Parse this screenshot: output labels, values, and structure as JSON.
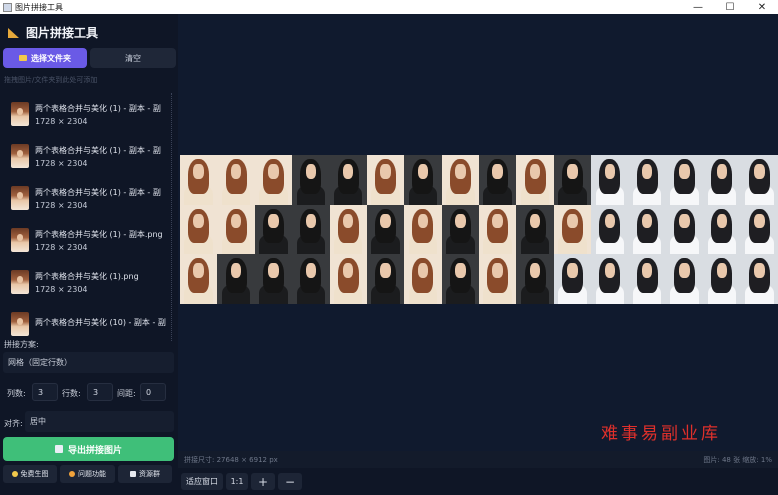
{
  "window": {
    "title": "图片拼接工具",
    "minimize": "—",
    "maximize": "☐",
    "close": "✕"
  },
  "sidebar": {
    "app_title": "图片拼接工具",
    "select_folder": "选择文件夹",
    "clear": "清空",
    "hint": "拖拽图片/文件夹到此处可添加",
    "files": [
      {
        "name": "两个表格合并与美化 (1) - 副本 - 副",
        "size": "1728 × 2304"
      },
      {
        "name": "两个表格合并与美化 (1) - 副本 - 副",
        "size": "1728 × 2304"
      },
      {
        "name": "两个表格合并与美化 (1) - 副本 - 副",
        "size": "1728 × 2304"
      },
      {
        "name": "两个表格合并与美化 (1) - 副本.png",
        "size": "1728 × 2304"
      },
      {
        "name": "两个表格合并与美化 (1).png",
        "size": "1728 × 2304"
      },
      {
        "name": "两个表格合并与美化 (10) - 副本 - 副",
        "size": ""
      }
    ],
    "scheme_label": "拼接方案:",
    "scheme_value": "网格（固定行数）",
    "cols_label": "列数:",
    "cols_value": "3",
    "rows_label": "行数:",
    "rows_value": "3",
    "gap_label": "间距:",
    "gap_value": "0",
    "align_label": "对齐:",
    "align_value": "居中",
    "export": "导出拼接图片",
    "free_gen": "免费生图",
    "feedback": "问题功能",
    "resource": "资源群"
  },
  "canvas": {
    "watermark": "难事易副业库",
    "mosaic_rows": [
      [
        "warm",
        "warm",
        "warm",
        "dark",
        "dark",
        "warm",
        "dark",
        "warm",
        "dark",
        "warm",
        "dark",
        "white",
        "white",
        "white",
        "white",
        "white"
      ],
      [
        "warm",
        "warm",
        "dark",
        "dark",
        "warm",
        "dark",
        "warm",
        "dark",
        "warm",
        "dark",
        "warm",
        "white",
        "white",
        "white",
        "white",
        "white"
      ],
      [
        "warm",
        "dark",
        "dark",
        "dark",
        "warm",
        "dark",
        "warm",
        "dark",
        "warm",
        "dark",
        "white",
        "white",
        "white",
        "white",
        "white",
        "white"
      ]
    ]
  },
  "status": {
    "size_text": "拼接尺寸: 27648 × 6912 px",
    "info_text": "图片: 48 张  缩放: 1%"
  },
  "zoom": {
    "fit": "适应窗口",
    "one_to_one": "1:1",
    "zoom_in": "+",
    "zoom_out": "−"
  },
  "colors": {
    "accent": "#6a5ae6",
    "export": "#3fbf79",
    "watermark": "#e0302b"
  }
}
